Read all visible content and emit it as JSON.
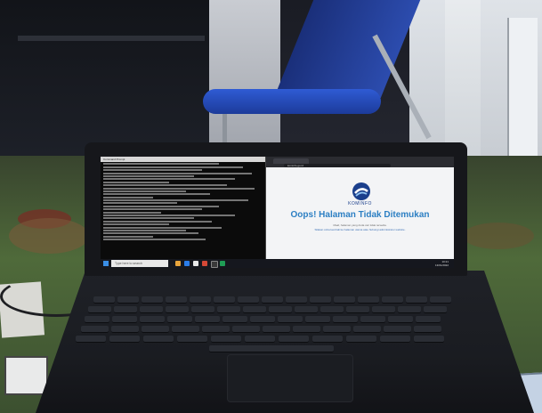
{
  "photo": {
    "subject": "laptop on floor showing a terminal and a browser error page"
  },
  "screen": {
    "terminal": {
      "title": "Command Prompt"
    },
    "browser": {
      "url": "kominfo.go.id",
      "brand": "KOMINFO",
      "error_title": "Oops! Halaman Tidak Ditemukan",
      "error_line1": "Maaf, halaman yang Anda cari tidak tersedia.",
      "error_line2": "Silakan coba kembali ke halaman utama atau hubungi administrator website."
    },
    "taskbar": {
      "search_placeholder": "Type here to search",
      "time": "10:21",
      "date": "13/01/2022"
    }
  },
  "colors": {
    "error_title": "#2c7fc3",
    "chair": "#2f5bd4",
    "logo": "#1b3f8c"
  }
}
